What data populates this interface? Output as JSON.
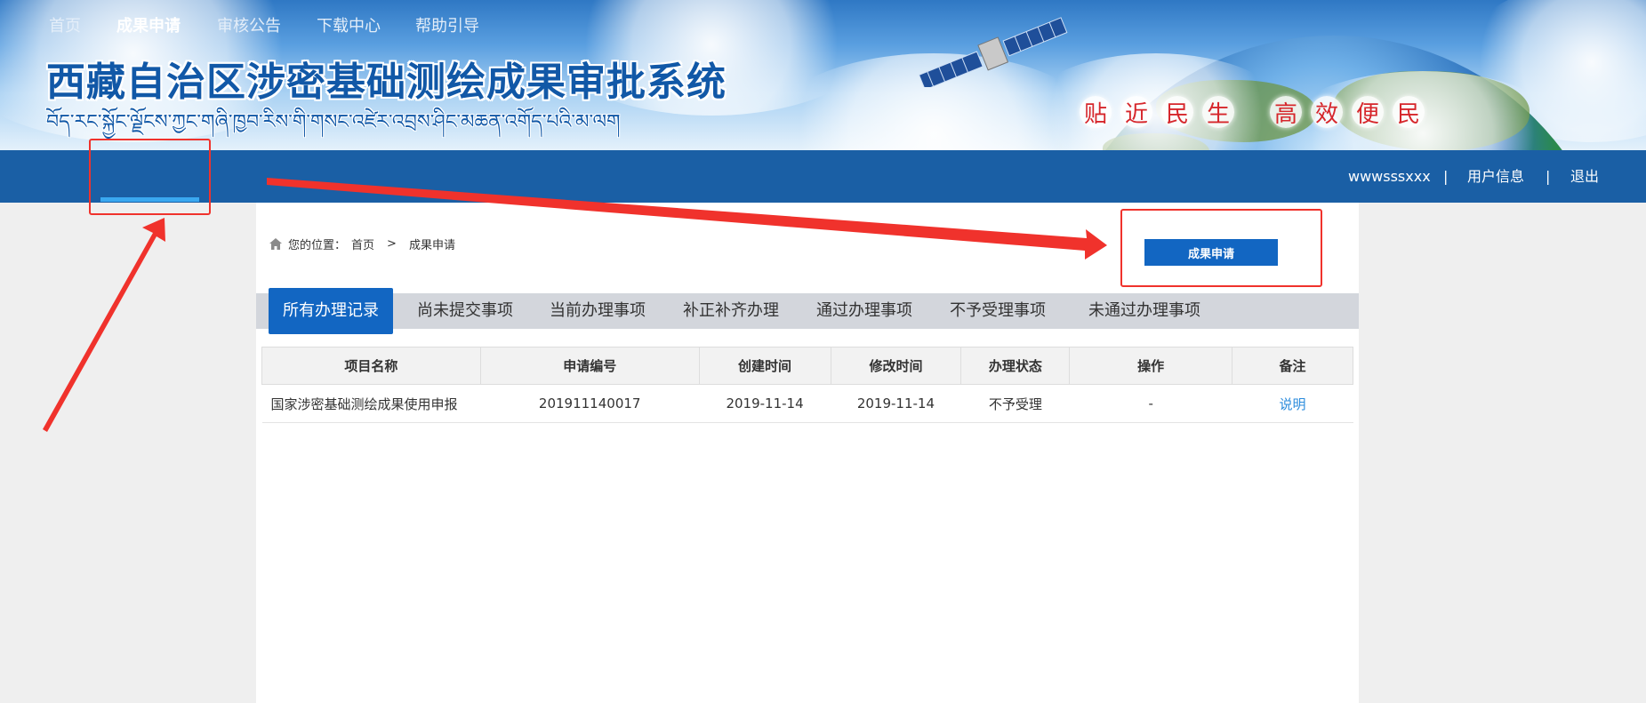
{
  "header": {
    "title_cn": "西藏自治区涉密基础测绘成果审批系统",
    "title_tibetan": "བོད་རང་སྐྱོང་ལྗོངས་ཀྱང་གཞི་ཁྱབ་རིས་གི་གསང་འཛེར་འབྲས་ཤིང་མཆན་འགོད་པའི་མ་ལག",
    "slogan_left": [
      "贴",
      "近",
      "民",
      "生"
    ],
    "slogan_right": [
      "高",
      "效",
      "便",
      "民"
    ]
  },
  "nav": {
    "items": [
      "首页",
      "成果申请",
      "审核公告",
      "下载中心",
      "帮助引导"
    ],
    "active_index": 1,
    "username": "wwwsssxxx",
    "separator": "|",
    "user_info": "用户信息",
    "logout": "退出"
  },
  "breadcrumb": {
    "prefix": "您的位置：",
    "home": "首页",
    "separator": ">",
    "current": "成果申请"
  },
  "apply_button": "成果申请",
  "tabs": [
    "所有办理记录",
    "尚未提交事项",
    "当前办理事项",
    "补正补齐办理",
    "通过办理事项",
    "不予受理事项",
    "未通过办理事项"
  ],
  "table": {
    "headers": [
      "项目名称",
      "申请编号",
      "创建时间",
      "修改时间",
      "办理状态",
      "操作",
      "备注"
    ],
    "rows": [
      [
        "国家涉密基础测绘成果使用申报",
        "201911140017",
        "2019-11-14",
        "2019-11-14",
        "不予受理",
        "-",
        "说明"
      ]
    ]
  },
  "colors": {
    "nav_bg": "#1a5fa5",
    "accent_blue": "#1266c2",
    "annotation_red": "#f0322c",
    "link": "#2a8bdc"
  }
}
